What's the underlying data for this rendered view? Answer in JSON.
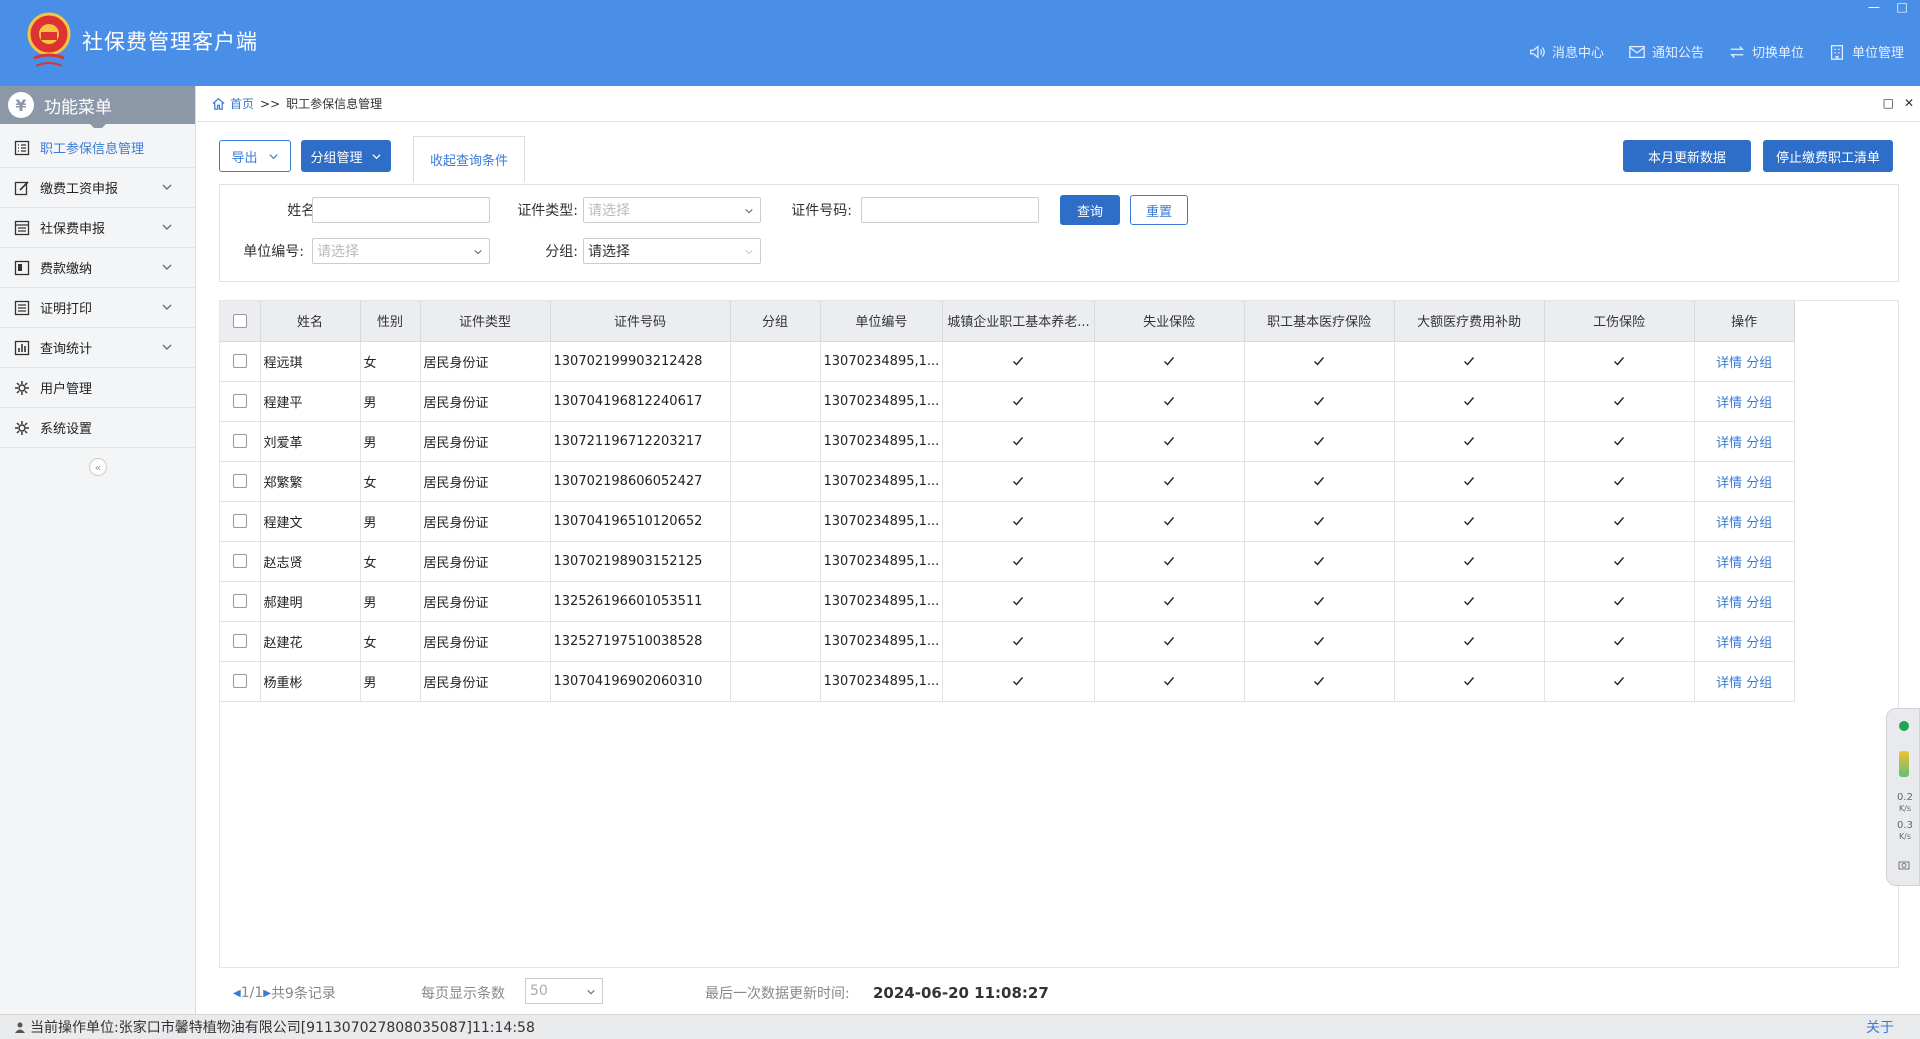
{
  "app": {
    "title": "社保费管理客户端",
    "window_controls": [
      "—",
      "□"
    ]
  },
  "header_nav": [
    {
      "label": "消息中心",
      "icon": "speaker-icon"
    },
    {
      "label": "通知公告",
      "icon": "mail-icon"
    },
    {
      "label": "切换单位",
      "icon": "switch-icon"
    },
    {
      "label": "单位管理",
      "icon": "building-icon"
    }
  ],
  "sidebar": {
    "header": "功能菜单",
    "header_icon": "¥",
    "items": [
      {
        "label": "职工参保信息管理",
        "active": true,
        "expandable": false,
        "icon": "list-icon"
      },
      {
        "label": "缴费工资申报",
        "active": false,
        "expandable": true,
        "icon": "edit-icon"
      },
      {
        "label": "社保费申报",
        "active": false,
        "expandable": true,
        "icon": "document-icon"
      },
      {
        "label": "费款缴纳",
        "active": false,
        "expandable": true,
        "icon": "book-icon"
      },
      {
        "label": "证明打印",
        "active": false,
        "expandable": true,
        "icon": "print-list-icon"
      },
      {
        "label": "查询统计",
        "active": false,
        "expandable": true,
        "icon": "chart-icon"
      },
      {
        "label": "用户管理",
        "active": false,
        "expandable": false,
        "icon": "gear-icon"
      },
      {
        "label": "系统设置",
        "active": false,
        "expandable": false,
        "icon": "gear-icon"
      }
    ],
    "collapse": "«"
  },
  "breadcrumb": {
    "home": "首页",
    "sep": ">>",
    "current": "职工参保信息管理"
  },
  "pane_controls": [
    "□",
    "✕"
  ],
  "toolbar": {
    "export": "导出",
    "group_manage": "分组管理",
    "collapse_tab": "收起查询条件",
    "update_month": "本月更新数据",
    "stop_list": "停止缴费职工清单"
  },
  "filters": {
    "name_label": "姓名:",
    "name_value": "",
    "id_type_label": "证件类型:",
    "id_type_placeholder": "请选择",
    "id_no_label": "证件号码:",
    "id_no_value": "",
    "query": "查询",
    "reset": "重置",
    "unit_no_label": "单位编号:",
    "unit_no_placeholder": "请选择",
    "group_label": "分组:",
    "group_value": "请选择"
  },
  "table": {
    "columns": [
      "",
      "姓名",
      "性别",
      "证件类型",
      "证件号码",
      "分组",
      "单位编号",
      "城镇企业职工基本养老...",
      "失业保险",
      "职工基本医疗保险",
      "大额医疗费用补助",
      "工伤保险",
      "操作"
    ],
    "actions": [
      "详情",
      "分组"
    ],
    "rows": [
      {
        "name": "程远琪",
        "gender": "女",
        "id_type": "居民身份证",
        "id_no": "130702199903212428",
        "group": "",
        "unit_no": "13070234895,1...",
        "pension": true,
        "unemployment": true,
        "medical": true,
        "major_medical": true,
        "injury": true
      },
      {
        "name": "程建平",
        "gender": "男",
        "id_type": "居民身份证",
        "id_no": "130704196812240617",
        "group": "",
        "unit_no": "13070234895,1...",
        "pension": true,
        "unemployment": true,
        "medical": true,
        "major_medical": true,
        "injury": true
      },
      {
        "name": "刘爱革",
        "gender": "男",
        "id_type": "居民身份证",
        "id_no": "130721196712203217",
        "group": "",
        "unit_no": "13070234895,1...",
        "pension": true,
        "unemployment": true,
        "medical": true,
        "major_medical": true,
        "injury": true
      },
      {
        "name": "郑繁繁",
        "gender": "女",
        "id_type": "居民身份证",
        "id_no": "130702198606052427",
        "group": "",
        "unit_no": "13070234895,1...",
        "pension": true,
        "unemployment": true,
        "medical": true,
        "major_medical": true,
        "injury": true
      },
      {
        "name": "程建文",
        "gender": "男",
        "id_type": "居民身份证",
        "id_no": "130704196510120652",
        "group": "",
        "unit_no": "13070234895,1...",
        "pension": true,
        "unemployment": true,
        "medical": true,
        "major_medical": true,
        "injury": true
      },
      {
        "name": "赵志贤",
        "gender": "女",
        "id_type": "居民身份证",
        "id_no": "130702198903152125",
        "group": "",
        "unit_no": "13070234895,1...",
        "pension": true,
        "unemployment": true,
        "medical": true,
        "major_medical": true,
        "injury": true
      },
      {
        "name": "郝建明",
        "gender": "男",
        "id_type": "居民身份证",
        "id_no": "132526196601053511",
        "group": "",
        "unit_no": "13070234895,1...",
        "pension": true,
        "unemployment": true,
        "medical": true,
        "major_medical": true,
        "injury": true
      },
      {
        "name": "赵建花",
        "gender": "女",
        "id_type": "居民身份证",
        "id_no": "132527197510038528",
        "group": "",
        "unit_no": "13070234895,1...",
        "pension": true,
        "unemployment": true,
        "medical": true,
        "major_medical": true,
        "injury": true
      },
      {
        "name": "杨重彬",
        "gender": "男",
        "id_type": "居民身份证",
        "id_no": "130704196902060310",
        "group": "",
        "unit_no": "13070234895,1...",
        "pension": true,
        "unemployment": true,
        "medical": true,
        "major_medical": true,
        "injury": true
      }
    ]
  },
  "pager": {
    "page": "1/1",
    "total": "共9条记录",
    "per_page_label": "每页显示条数",
    "per_page_value": "50",
    "last_update_label": "最后一次数据更新时间:",
    "last_update_value": "2024-06-20 11:08:27"
  },
  "statusbar": {
    "label": "当前操作单位:",
    "value": "张家口市馨特植物油有限公司[911307027808035087]11:14:58",
    "about": "关于"
  },
  "float_widget": {
    "up": "0.2",
    "down": "0.3",
    "unit": "K/s"
  },
  "colors": {
    "header": "#4a8fe7",
    "primary": "#2e6ec8",
    "link": "#3a7bd5"
  }
}
